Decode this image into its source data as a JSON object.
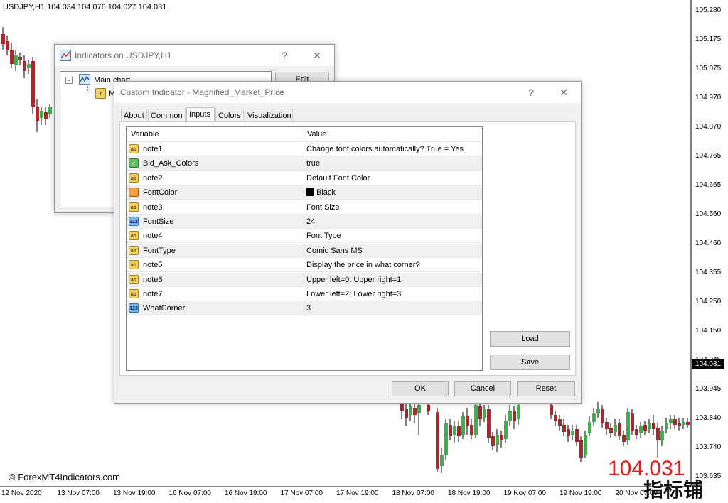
{
  "chart": {
    "header": "USDJPY,H1  104.034 104.076 104.027 104.031",
    "price_axis": [
      "105.280",
      "105.175",
      "105.075",
      "104.970",
      "104.870",
      "104.765",
      "104.665",
      "104.560",
      "104.460",
      "104.355",
      "104.250",
      "104.150",
      "104.045",
      "103.945",
      "103.840",
      "103.740",
      "103.635"
    ],
    "current_price": "104.031",
    "time_axis": [
      "12 Nov 2020",
      "13 Nov 07:00",
      "13 Nov 19:00",
      "16 Nov 07:00",
      "16 Nov 19:00",
      "17 Nov 07:00",
      "17 Nov 19:00",
      "18 Nov 07:00",
      "18 Nov 19:00",
      "19 Nov 07:00",
      "19 Nov 19:00",
      "20 Nov 07:00"
    ],
    "watermark": "© ForexMT4Indicators.com",
    "big_price": "104.031",
    "cn_mark": "指标铺",
    "bull_color": "#3cb04a",
    "bear_color": "#a8282e"
  },
  "indicators_window": {
    "title": "Indicators on USDJPY,H1",
    "help": "?",
    "close": "✕",
    "tree_root": "Main chart",
    "tree_child": "M",
    "edit_button": "Edit"
  },
  "dialog": {
    "title": "Custom Indicator - Magnified_Market_Price",
    "help": "?",
    "close": "✕",
    "tabs": [
      "About",
      "Common",
      "Inputs",
      "Colors",
      "Visualization"
    ],
    "active_tab": "Inputs",
    "columns": {
      "variable": "Variable",
      "value": "Value"
    },
    "rows": [
      {
        "icon": "ab",
        "variable": "note1",
        "value": "Change font colors automatically? True = Yes"
      },
      {
        "icon": "bool",
        "variable": "Bid_Ask_Colors",
        "value": "true"
      },
      {
        "icon": "ab",
        "variable": "note2",
        "value": "Default Font Color"
      },
      {
        "icon": "color",
        "variable": "FontColor",
        "value": "Black"
      },
      {
        "icon": "ab",
        "variable": "note3",
        "value": "Font Size"
      },
      {
        "icon": "num",
        "variable": "FontSize",
        "value": "24"
      },
      {
        "icon": "ab",
        "variable": "note4",
        "value": "Font Type"
      },
      {
        "icon": "ab",
        "variable": "FontType",
        "value": "Comic Sans MS"
      },
      {
        "icon": "ab",
        "variable": "note5",
        "value": "Display the price in what corner?"
      },
      {
        "icon": "ab",
        "variable": "note6",
        "value": "Upper left=0; Upper right=1"
      },
      {
        "icon": "ab",
        "variable": "note7",
        "value": "Lower left=2; Lower right=3"
      },
      {
        "icon": "num",
        "variable": "WhatCorner",
        "value": "3"
      }
    ],
    "icon_text": {
      "ab": "ab",
      "num": "123",
      "bool": "✓",
      "color": ""
    },
    "load_button": "Load",
    "save_button": "Save",
    "ok_button": "OK",
    "cancel_button": "Cancel",
    "reset_button": "Reset"
  }
}
